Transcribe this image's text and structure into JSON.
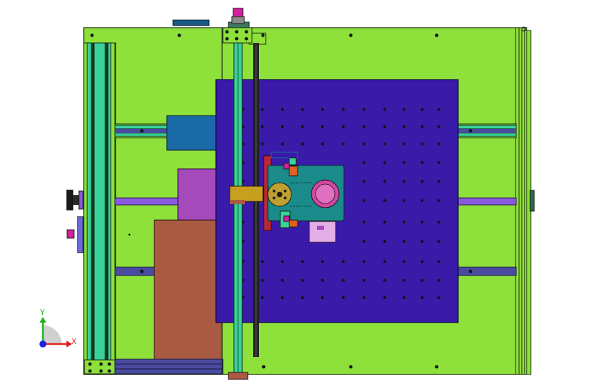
{
  "viewport": {
    "background": "#ffffff",
    "colors": {
      "frame_green": "#8ee03a",
      "rail_teal": "#3ad29a",
      "rail_dark": "#1c3a22",
      "table_blue": "#3a1aa8",
      "slider_blue": "#1a6aa8",
      "magenta_block": "#a44aba",
      "brown_block": "#a85a42",
      "rod_purple": "#8a5ae0",
      "teal_motor": "#1a8a8a",
      "tan_block": "#c8a020",
      "red_plate": "#b8283a",
      "pink_block": "#e4aee6",
      "hole": "#101818"
    }
  },
  "triad": {
    "x_label": "X",
    "y_label": "Y",
    "x_color": "#e02020",
    "y_color": "#20b020",
    "z_color": "#2020e0"
  }
}
